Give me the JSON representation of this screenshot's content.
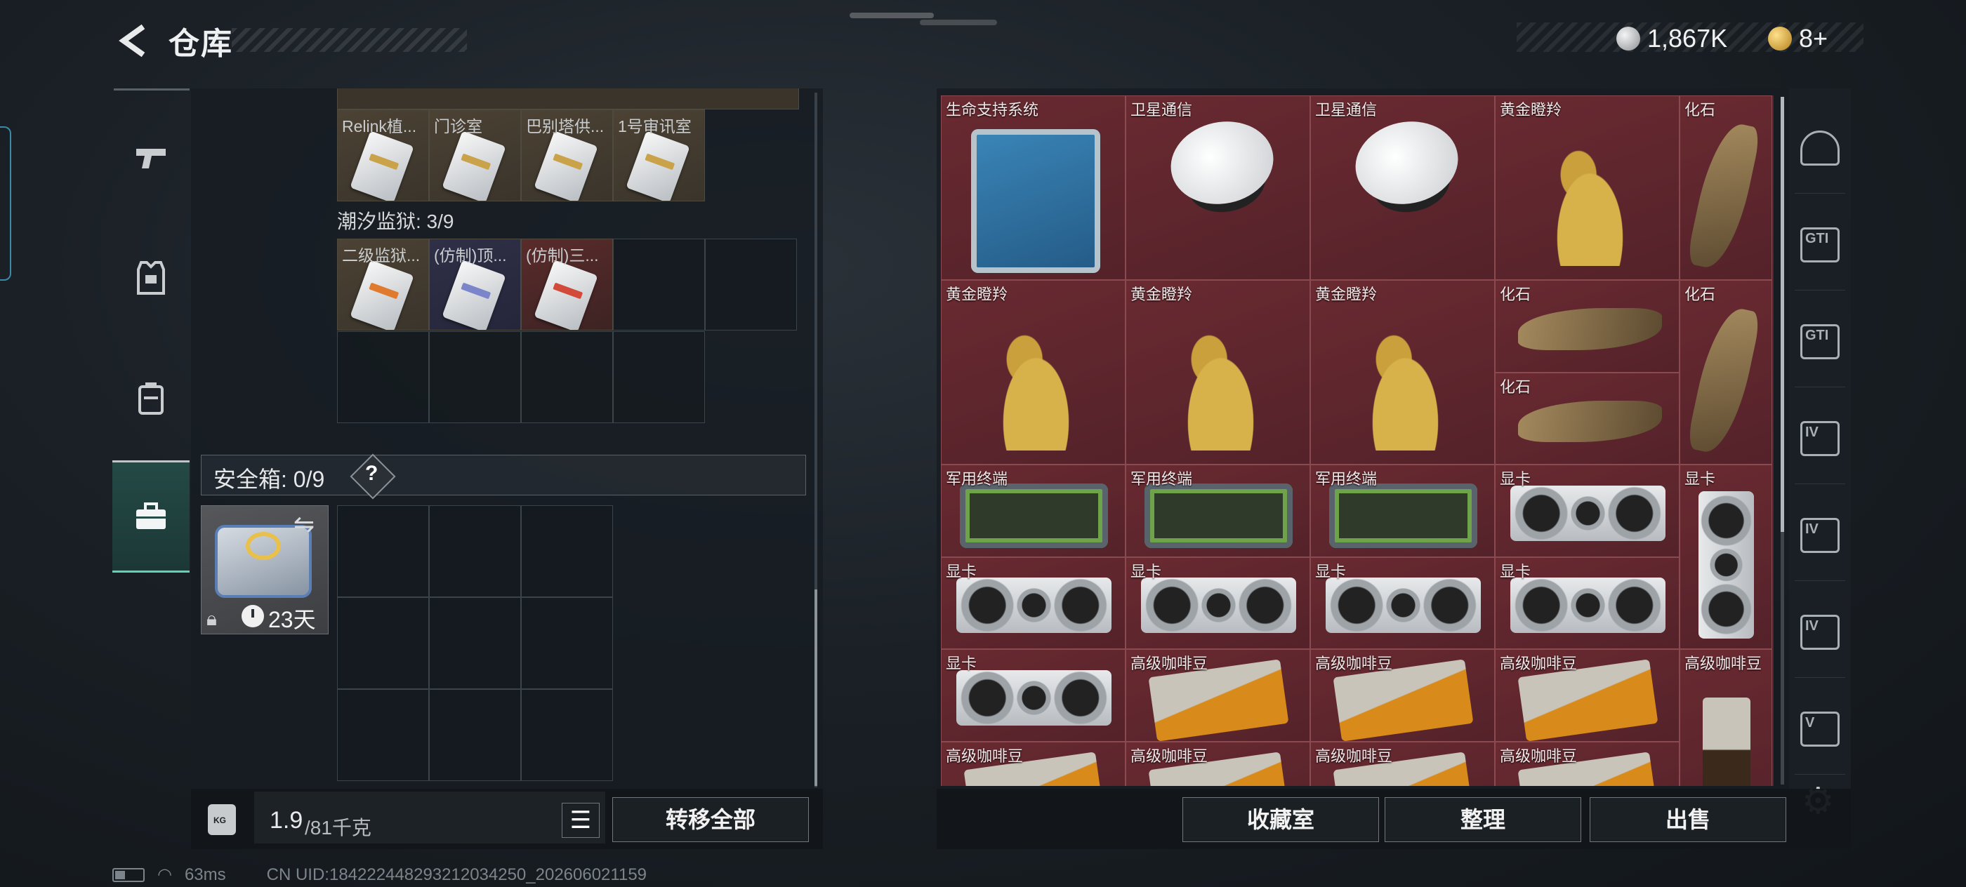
{
  "header": {
    "title": "仓库",
    "currency": [
      {
        "icon": "silver-coin-icon",
        "value": "1,867K"
      },
      {
        "icon": "gold-coin-icon",
        "value": "8+"
      }
    ]
  },
  "left_rail": {
    "items": [
      {
        "icon": "gun-icon",
        "active": false
      },
      {
        "icon": "armor-icon",
        "active": false
      },
      {
        "icon": "backpack-icon",
        "active": false
      },
      {
        "icon": "briefcase-icon",
        "active": true
      }
    ]
  },
  "keys_top": [
    {
      "label": "Relink植...",
      "style": "gold",
      "bar": "gold"
    },
    {
      "label": "门诊室",
      "style": "gold",
      "bar": "gold"
    },
    {
      "label": "巴别塔供...",
      "style": "gold",
      "bar": "gold"
    },
    {
      "label": "1号审讯室",
      "style": "gold",
      "bar": "gold"
    }
  ],
  "prison": {
    "title": "潮汐监狱: 3/9",
    "keys": [
      {
        "label": "二级监狱...",
        "style": "gold",
        "bar": "orange"
      },
      {
        "label": "(仿制)顶...",
        "style": "purple",
        "bar": "blue"
      },
      {
        "label": "(仿制)三...",
        "style": "red",
        "bar": "redbar"
      }
    ]
  },
  "safebox": {
    "label": "安全箱: 0/9",
    "help": "?",
    "timer": "23天"
  },
  "weight": {
    "value": "1.9",
    "capacity": "/81千克"
  },
  "buttons": {
    "list_icon": "☰",
    "transfer_all": "转移全部",
    "collection_room": "收藏室",
    "organize": "整理",
    "sell": "出售"
  },
  "stash_items": [
    {
      "label": "生命支持系统",
      "art": "life-support"
    },
    {
      "label": "卫星通信",
      "art": "satellite"
    },
    {
      "label": "卫星通信",
      "art": "satellite"
    },
    {
      "label": "黄金瞪羚",
      "art": "gazelle"
    },
    {
      "label": "化石",
      "art": "fossil-v"
    },
    {
      "label": "黄金瞪羚",
      "art": "gazelle"
    },
    {
      "label": "黄金瞪羚",
      "art": "gazelle"
    },
    {
      "label": "黄金瞪羚",
      "art": "gazelle"
    },
    {
      "label": "化石",
      "art": "fossil-h"
    },
    {
      "label": "化石",
      "art": "fossil-v"
    },
    {
      "label": "化石",
      "art": "fossil-h"
    },
    {
      "label": "军用终端",
      "art": "terminal"
    },
    {
      "label": "军用终端",
      "art": "terminal"
    },
    {
      "label": "军用终端",
      "art": "terminal"
    },
    {
      "label": "显卡",
      "art": "gpu-h"
    },
    {
      "label": "显卡",
      "art": "gpu-v"
    },
    {
      "label": "显卡",
      "art": "gpu-h"
    },
    {
      "label": "显卡",
      "art": "gpu-h"
    },
    {
      "label": "显卡",
      "art": "gpu-h"
    },
    {
      "label": "显卡",
      "art": "gpu-h"
    },
    {
      "label": "显卡",
      "art": "gpu-h"
    },
    {
      "label": "高级咖啡豆",
      "art": "coffee-h"
    },
    {
      "label": "高级咖啡豆",
      "art": "coffee-h"
    },
    {
      "label": "高级咖啡豆",
      "art": "coffee-h"
    },
    {
      "label": "高级咖啡豆",
      "art": "coffee-v"
    },
    {
      "label": "高级咖啡豆",
      "art": "coffee-h"
    },
    {
      "label": "高级咖啡豆",
      "art": "coffee-h"
    },
    {
      "label": "高级咖啡豆",
      "art": "coffee-h"
    },
    {
      "label": "高级咖啡豆",
      "art": "coffee-h"
    }
  ],
  "right_rail": {
    "items": [
      {
        "icon": "storage-icon",
        "text": ""
      },
      {
        "icon": "gti-folder-icon",
        "text": "GTI"
      },
      {
        "icon": "gti-hand-icon",
        "text": "GTI"
      },
      {
        "icon": "iv-folder-icon",
        "text": "IV"
      },
      {
        "icon": "iv-folder-icon-2",
        "text": "IV"
      },
      {
        "icon": "iv-add-icon",
        "text": "IV"
      },
      {
        "icon": "v-cash-icon",
        "text": "V"
      }
    ],
    "settings_icon": "⚙"
  },
  "status": {
    "ping": "63ms",
    "uid": "CN UID:18422244829321203425​0_202606021159"
  }
}
